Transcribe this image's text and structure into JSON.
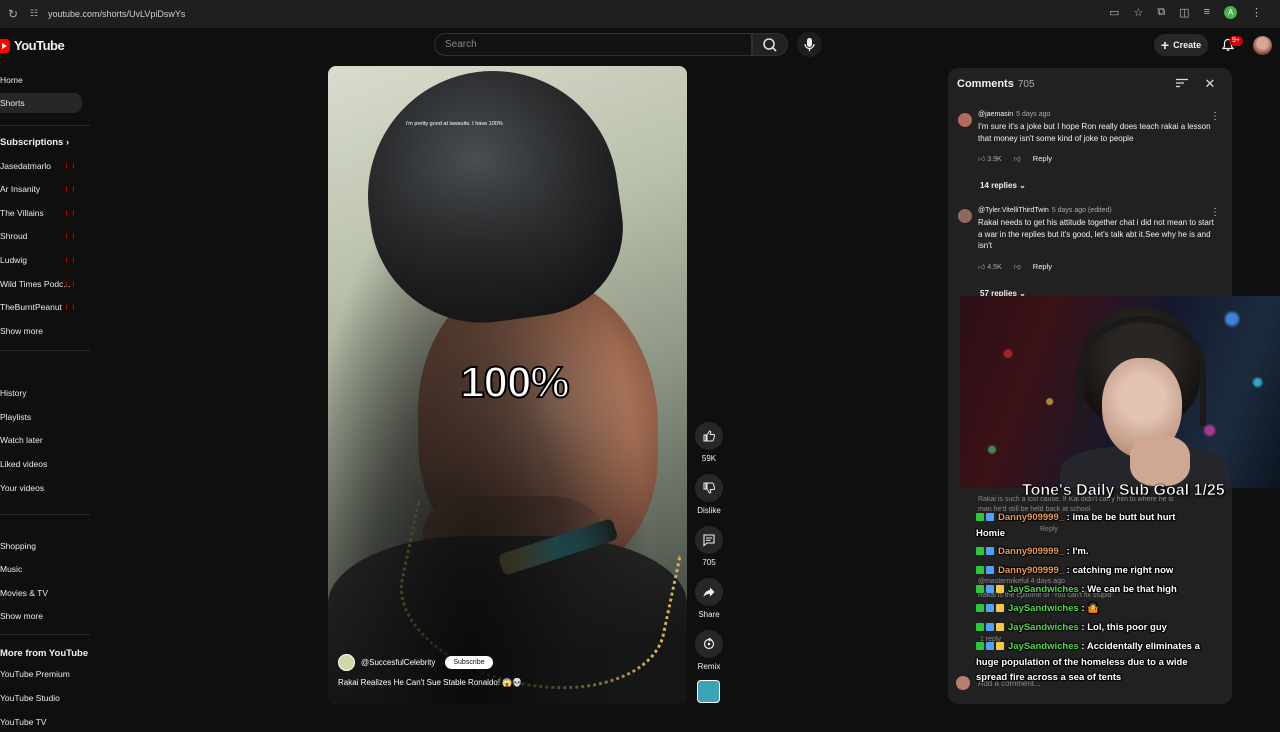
{
  "browser": {
    "url": "youtube.com/shorts/UvLVpiDswYs",
    "profile_initial": "A"
  },
  "header": {
    "logo": "YouTube",
    "search_placeholder": "Search",
    "create_label": "Create",
    "notifications_badge": "9+"
  },
  "sidebar": {
    "top": [
      {
        "label": "Home"
      },
      {
        "label": "Shorts",
        "active": true
      }
    ],
    "subscriptions_heading": "Subscriptions",
    "subscriptions": [
      {
        "label": "Jasedatmarlo"
      },
      {
        "label": "Ar Insanity"
      },
      {
        "label": "The Villains"
      },
      {
        "label": "Shroud"
      },
      {
        "label": "Ludwig"
      },
      {
        "label": "Wild Times Podc..."
      },
      {
        "label": "TheBurntPeanut"
      }
    ],
    "show_more_1": "Show more",
    "you": [
      {
        "label": "History"
      },
      {
        "label": "Playlists"
      },
      {
        "label": "Watch later"
      },
      {
        "label": "Liked videos"
      },
      {
        "label": "Your videos"
      }
    ],
    "explore": [
      {
        "label": "Shopping"
      },
      {
        "label": "Music"
      },
      {
        "label": "Movies & TV"
      }
    ],
    "show_more_2": "Show more",
    "more_from_heading": "More from YouTube",
    "more_from": [
      {
        "label": "YouTube Premium"
      },
      {
        "label": "YouTube Studio"
      },
      {
        "label": "YouTube TV"
      }
    ]
  },
  "video": {
    "caption_small": "i'm pretty good at lawsuits. I have 100%",
    "big_text": "100%",
    "channel": "@SuccesfulCelebrity",
    "subscribe_label": "Subscribe",
    "title": "Rakai Realizes He Can't Sue Stable Ronaldo! 😱💀"
  },
  "actions": {
    "likes": "59K",
    "dislike_label": "Dislike",
    "comments_count": "705",
    "share_label": "Share",
    "remix_label": "Remix"
  },
  "comments": {
    "title": "Comments",
    "count": "705",
    "items": [
      {
        "author": "@jaemasin",
        "time": "5 days ago",
        "text": "I'm sure it's a joke but I hope Ron really does teach rakai a lesson that money isn't some kind of joke to people",
        "likes": "3.9K",
        "reply_label": "Reply",
        "replies": "14 replies"
      },
      {
        "author": "@Tyler.VitelliThirdTwin",
        "time": "5 days ago (edited)",
        "text": "Rakai needs to get his attitude together chat i did not mean to start a war in the replies but it's good, let's talk abt it.See why he is and isn't",
        "likes": "4.5K",
        "reply_label": "Reply",
        "replies": "57 replies"
      }
    ],
    "ghost_lines": [
      "Rakai is such a lost cause. If Kai didn't carry him to where he is",
      "man he'd still be held back at school",
      "Reply",
      "@mastermikeful 4 days ago",
      "Rakai is the epitome of \"You can't fix stupid\"",
      "1 reply"
    ],
    "add_placeholder": "Add a comment..."
  },
  "stream_overlay": {
    "goal_text": "Tone's Daily Sub Goal 1/25",
    "chat": [
      {
        "user": "Danny909999_",
        "msg": "ima be be butt but hurt",
        "color": "#e79a52"
      },
      {
        "user": "",
        "msg": "Homie",
        "color": "#ffffff"
      },
      {
        "user": "Danny909999_",
        "msg": "I'm.",
        "color": "#e79a52"
      },
      {
        "user": "Danny909999_",
        "msg": "catching me right now",
        "color": "#e79a52"
      },
      {
        "user": "JaySandwiches",
        "msg": "We can be that high",
        "color": "#51d84b"
      },
      {
        "user": "JaySandwiches",
        "msg": "🤷",
        "color": "#51d84b"
      },
      {
        "user": "JaySandwiches",
        "msg": "Lol, this poor guy",
        "color": "#51d84b"
      },
      {
        "user": "JaySandwiches",
        "msg": "Accidentally eliminates a",
        "color": "#51d84b"
      },
      {
        "user": "",
        "msg": "huge population of the homeless due to a wide",
        "color": "#ffffff"
      },
      {
        "user": "",
        "msg": "spread fire across a sea of tents",
        "color": "#ffffff"
      }
    ]
  }
}
